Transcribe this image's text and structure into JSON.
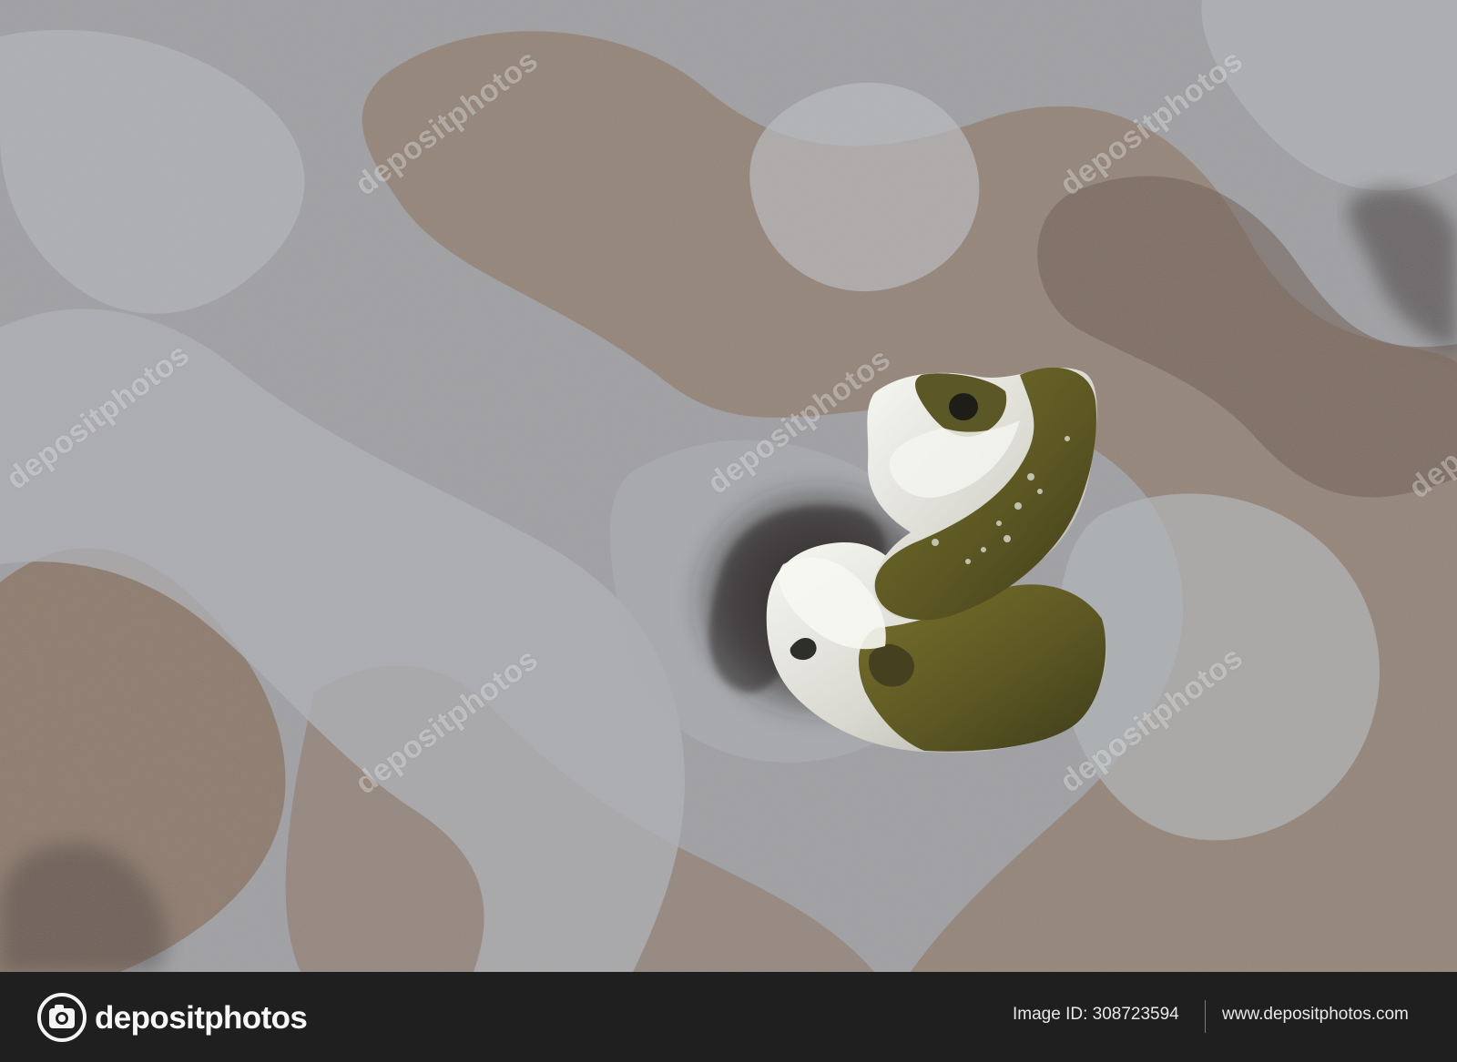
{
  "watermark_text": "depositphotos",
  "footer": {
    "brand": "depositphotos",
    "image_id": "Image ID: 308723594",
    "url": "www.depositphotos.com"
  },
  "palette": {
    "concrete": "#8f8f93",
    "light_concrete": "#b4b7bb",
    "gravel": "#8b735f",
    "dark_gravel": "#5b4d43",
    "foam": "#ecece7",
    "olive": "#5f5a25",
    "footer": "#1f1f1f"
  },
  "icons": {
    "logo": "camera-icon"
  }
}
